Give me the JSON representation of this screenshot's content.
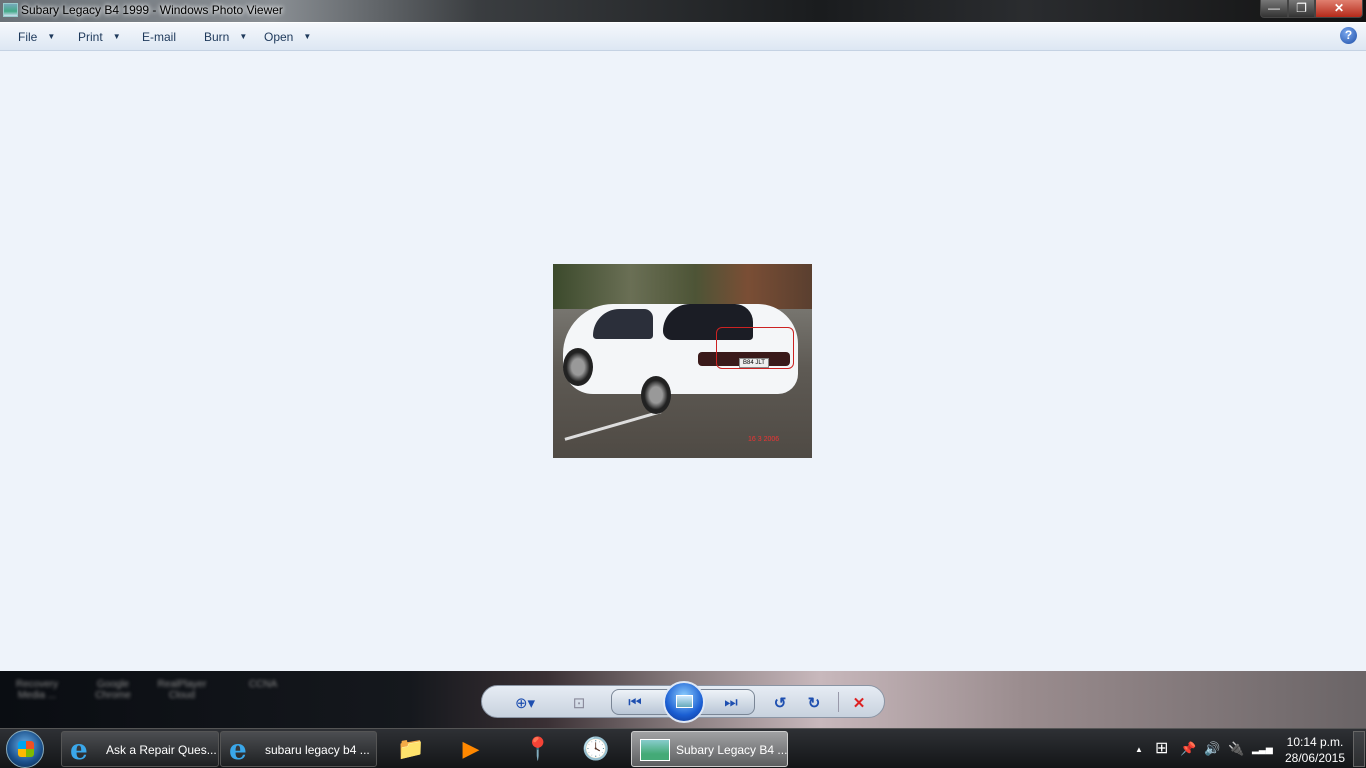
{
  "window": {
    "title": "Subary Legacy B4 1999 - Windows Photo Viewer",
    "minimize": "—",
    "maximize": "❐",
    "close": "✕"
  },
  "menu": [
    {
      "label": "File",
      "caret": "▼"
    },
    {
      "label": "Print",
      "caret": "▼"
    },
    {
      "label": "E-mail",
      "caret": ""
    },
    {
      "label": "Burn",
      "caret": "▼"
    },
    {
      "label": "Open",
      "caret": "▼"
    }
  ],
  "help": "?",
  "photo": {
    "plate": "B84 JLT",
    "date_stamp": "16 3 2006"
  },
  "desktop_icons": [
    "Recovery Media ...",
    "Google Chrome",
    "RealPlayer Cloud",
    "CCNA"
  ],
  "controls": {
    "zoom": "⊕▾",
    "fit": "⊡",
    "prev": "⏮",
    "next": "⏭",
    "rotate_ccw": "↺",
    "rotate_cw": "↻",
    "delete": "✕"
  },
  "taskbar": {
    "items": [
      {
        "label": "Ask a Repair Ques..."
      },
      {
        "label": "subaru legacy b4 ..."
      },
      {
        "label": "Subary Legacy B4 ..."
      }
    ]
  },
  "tray": {
    "time": "10:14 p.m.",
    "date": "28/06/2015",
    "arrow": "▲",
    "flag": "⊞",
    "pin": "📌",
    "volume": "🔊",
    "power": "🔌",
    "signal": "▂▃▅"
  }
}
